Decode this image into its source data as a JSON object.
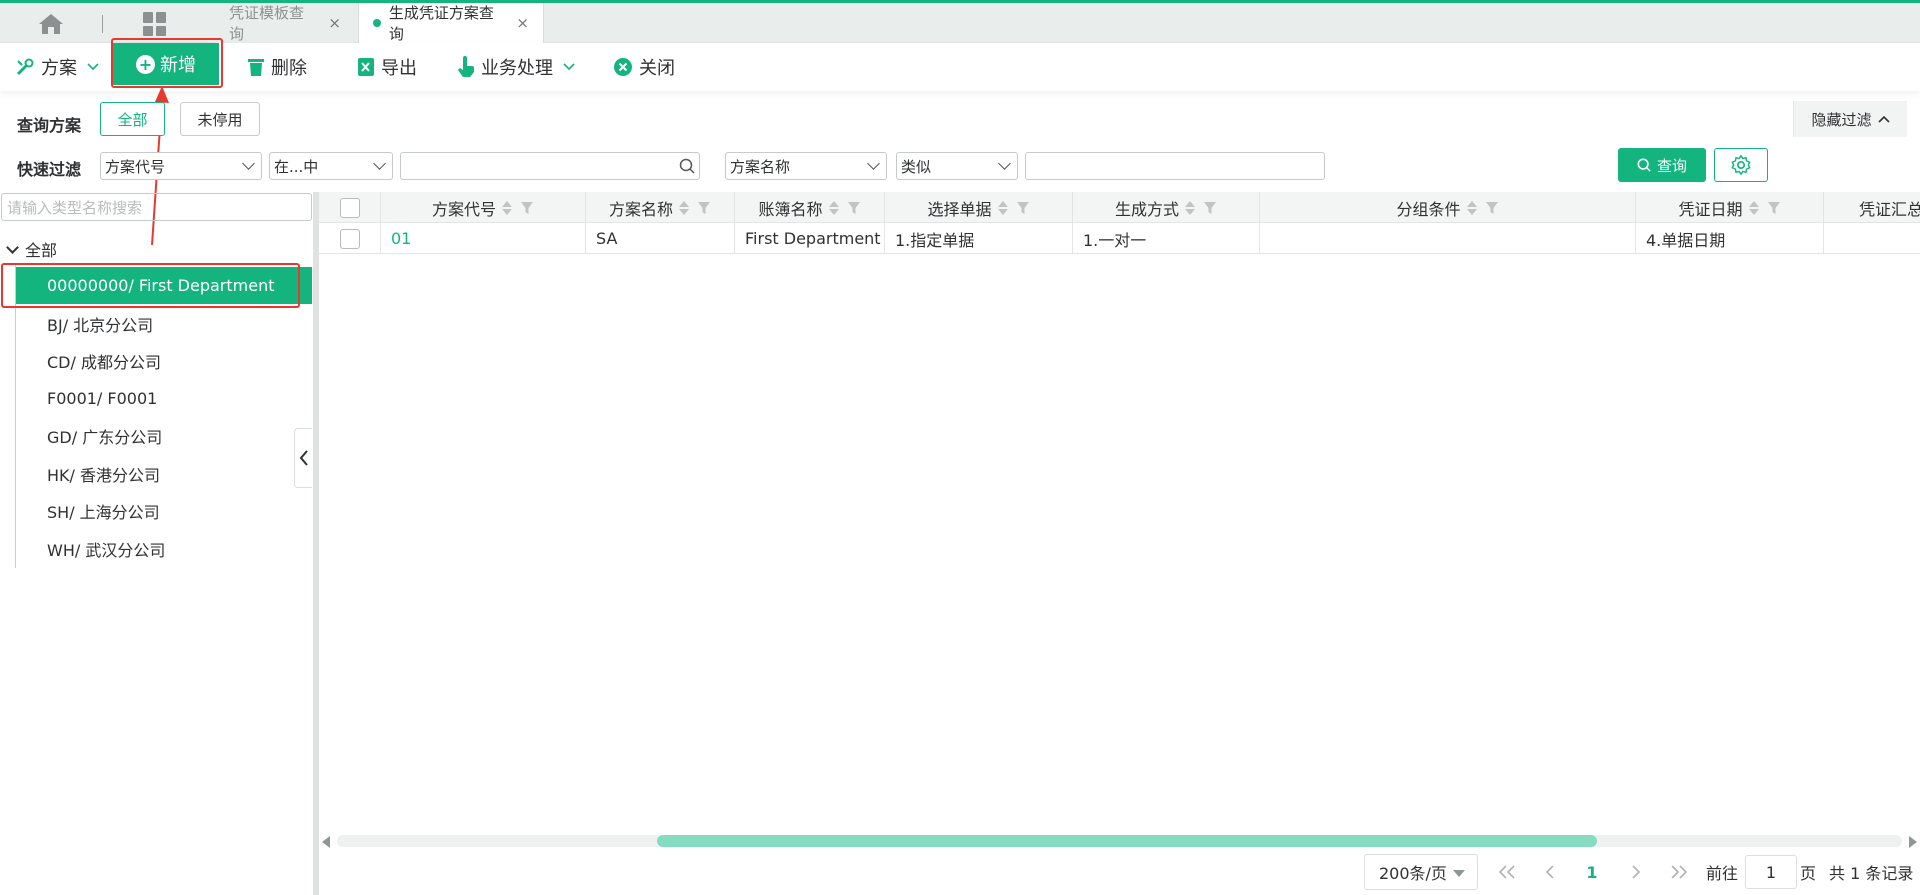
{
  "tabs": [
    {
      "label": "凭证模板查询",
      "active": false
    },
    {
      "label": "生成凭证方案查询",
      "active": true
    }
  ],
  "toolbar": {
    "scheme_label": "方案",
    "new_label": "新增",
    "delete_label": "删除",
    "export_label": "导出",
    "business_label": "业务处理",
    "close_label": "关闭"
  },
  "query": {
    "scheme_label": "查询方案",
    "chip_all": "全部",
    "chip_enabled": "未停用",
    "hide_filter": "隐藏过滤",
    "quick_filter_label": "快速过滤",
    "filter1_field": "方案代号",
    "filter1_op": "在...中",
    "filter1_value": "",
    "filter2_field": "方案名称",
    "filter2_op": "类似",
    "filter2_value": "",
    "query_button": "查询"
  },
  "tree": {
    "search_placeholder": "请输入类型名称搜索",
    "root": "全部",
    "items": [
      "00000000/ First Department",
      "BJ/ 北京分公司",
      "CD/ 成都分公司",
      "F0001/ F0001",
      "GD/ 广东分公司",
      "HK/ 香港分公司",
      "SH/ 上海分公司",
      "WH/ 武汉分公司"
    ],
    "selected_index": 0
  },
  "grid": {
    "columns": [
      "方案代号",
      "方案名称",
      "账簿名称",
      "选择单据",
      "生成方式",
      "分组条件",
      "凭证日期",
      "凭证汇总"
    ],
    "rows": [
      [
        "01",
        "SA",
        "First Department",
        "1.指定单据",
        "1.一对一",
        "",
        "4.单据日期",
        ""
      ]
    ]
  },
  "pager": {
    "page_size": "200条/页",
    "current_page": "1",
    "goto_label": "前往",
    "goto_value": "1",
    "page_unit": "页",
    "total": "共 1 条记录"
  },
  "colors": {
    "accent": "#14b47e",
    "highlight": "#e8392f"
  }
}
